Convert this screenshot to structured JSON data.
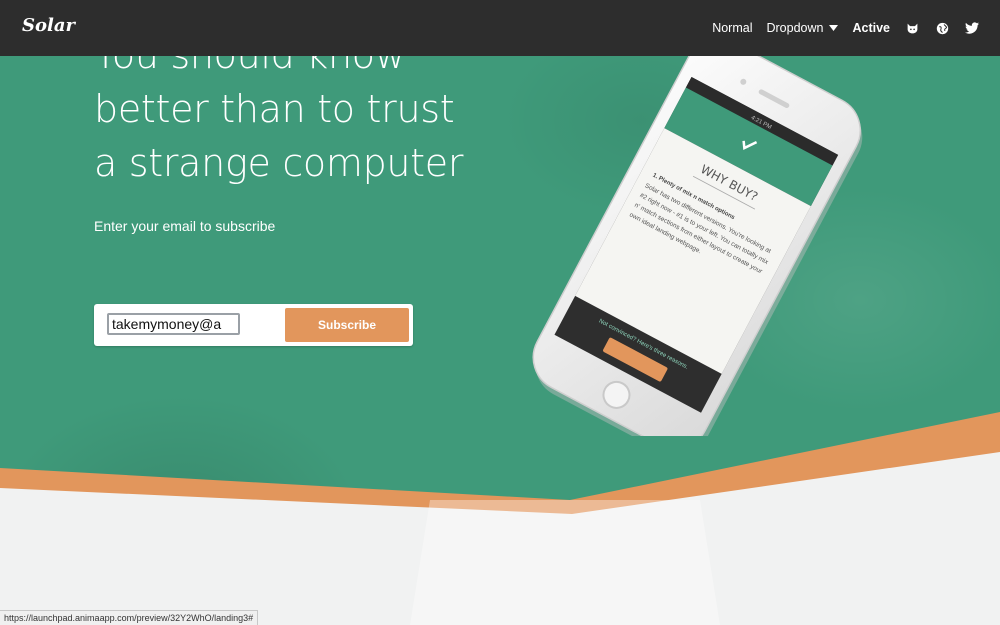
{
  "navbar": {
    "brand": "Solar",
    "links": [
      {
        "label": "Normal"
      },
      {
        "label": "Dropdown"
      },
      {
        "label": "Active"
      }
    ],
    "icons": [
      "github-icon",
      "globe-icon",
      "twitter-icon"
    ]
  },
  "hero": {
    "headline": [
      "You should know",
      "better than to trust",
      "a strange computer"
    ],
    "subtitle": "Enter your email to subscribe",
    "email_value": "takemymoney@a",
    "subscribe_label": "Subscribe"
  },
  "phone_screen": {
    "heading": "WHY BUY?",
    "item": "1. Plenty of mix n match options",
    "body": "Solar has two different versions. You're looking at #2 right now - #1 is to your left. You can totally mix n' match sections from either layout to create your own ideal landing webpage.",
    "bottom_text": "Not convinced? Here's three reasons.",
    "time": "4:21 PM"
  },
  "status_bar": {
    "url": "https://launchpad.animaapp.com/preview/32Y2WhO/landing3#"
  },
  "colors": {
    "nav_bg": "#2d2d2d",
    "hero_green": "#3f9a7a",
    "accent_orange": "#e2965c",
    "light_bg": "#f1f2f2"
  }
}
